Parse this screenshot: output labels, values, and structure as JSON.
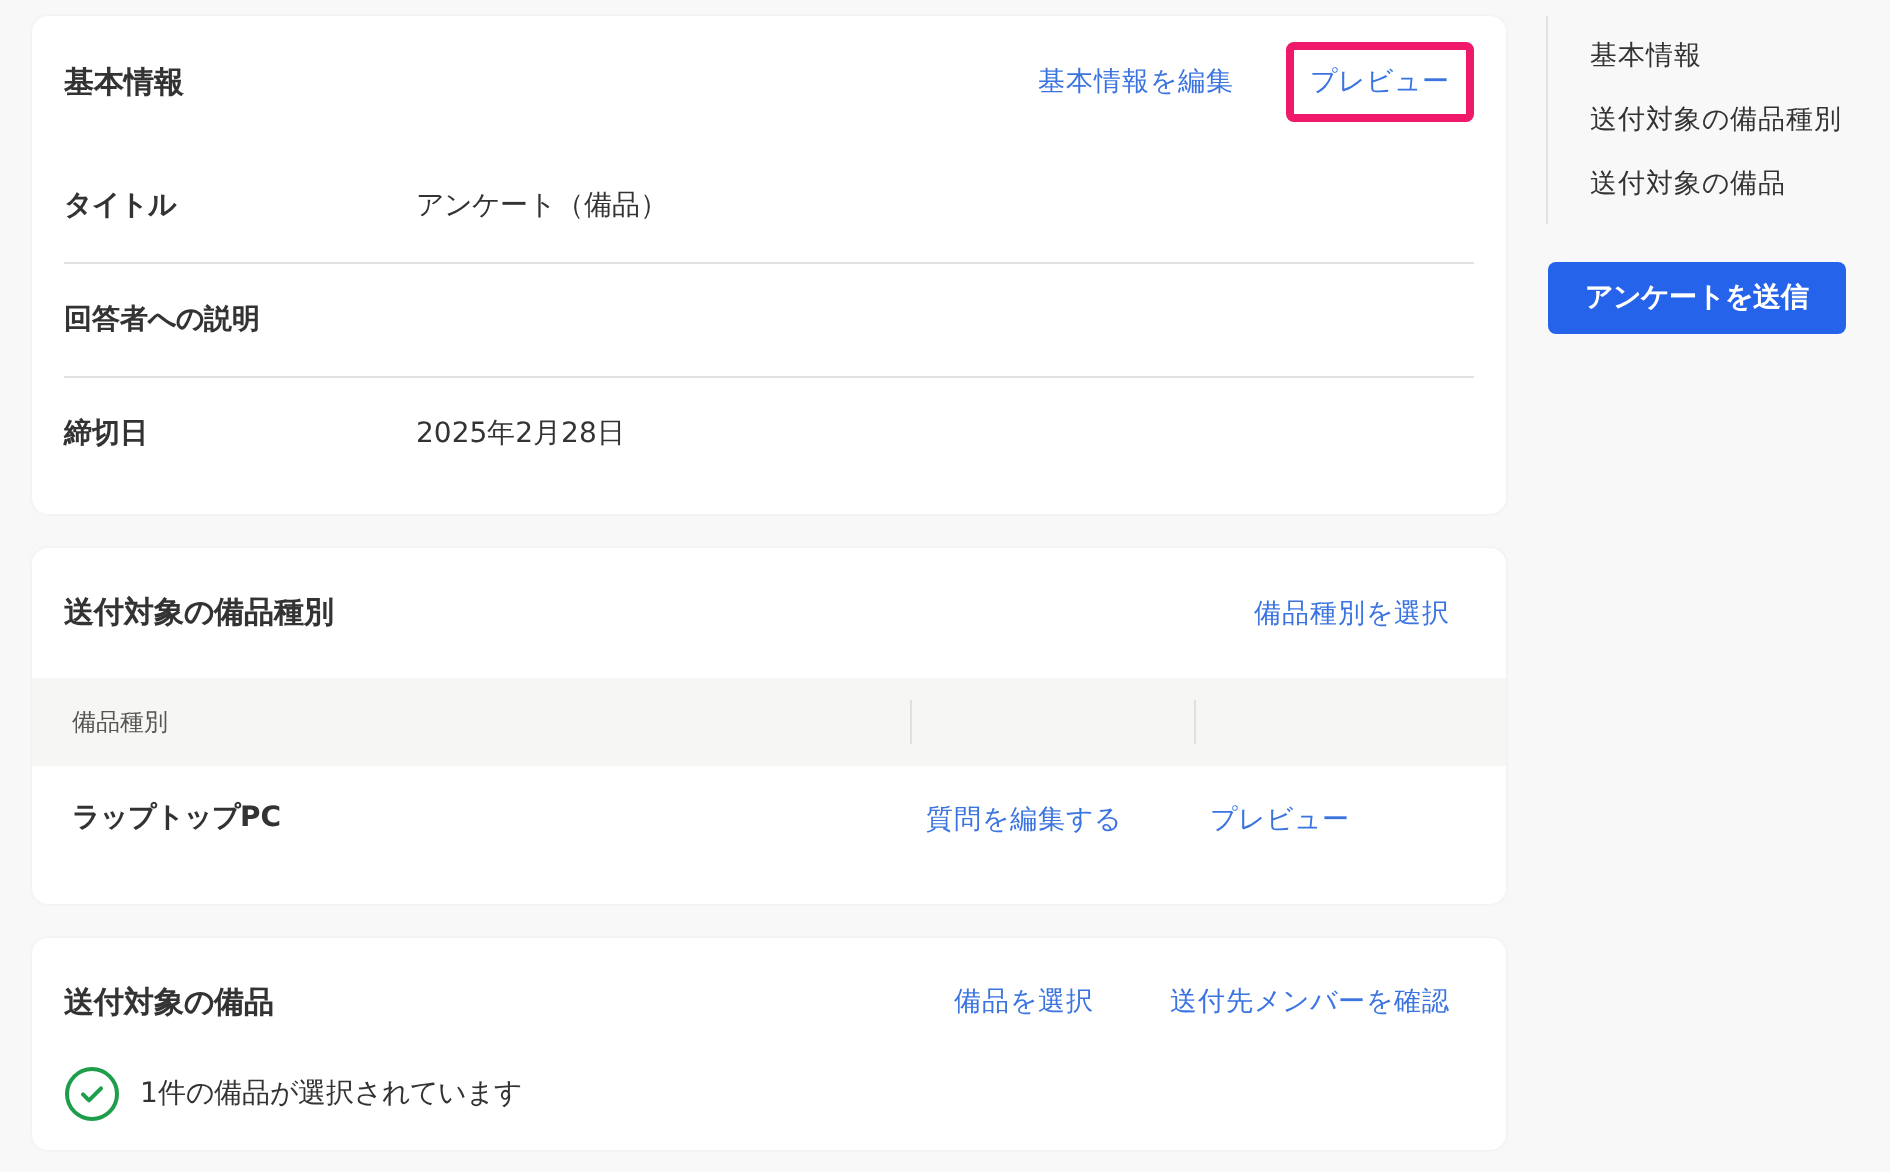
{
  "basic_info": {
    "title": "基本情報",
    "actions": [
      {
        "label": "基本情報を編集",
        "highlighted": false
      },
      {
        "label": "プレビュー",
        "highlighted": true
      }
    ],
    "fields": [
      {
        "label": "タイトル",
        "value": "アンケート（備品）"
      },
      {
        "label": "回答者への説明"
      },
      {
        "label": "締切日",
        "value": "2025年2月28日"
      }
    ]
  },
  "equipment_types": {
    "title": "送付対象の備品種別",
    "actions": [
      {
        "label": "備品種別を選択",
        "highlighted": false
      }
    ],
    "table": {
      "columns": [
        "備品種別"
      ],
      "rows": [
        {
          "name": "ラップトップPC",
          "actions": [
            "質問を編集する",
            "プレビュー"
          ]
        }
      ]
    }
  },
  "equipment": {
    "title": "送付対象の備品",
    "actions": [
      {
        "label": "備品を選択",
        "highlighted": false
      },
      {
        "label": "送付先メンバーを確認",
        "highlighted": false
      }
    ],
    "status": {
      "text": "1件の備品が選択されています",
      "ok": true
    }
  },
  "sidebar": {
    "items": [
      "基本情報",
      "送付対象の備品種別",
      "送付対象の備品"
    ],
    "button": "アンケートを送信"
  }
}
